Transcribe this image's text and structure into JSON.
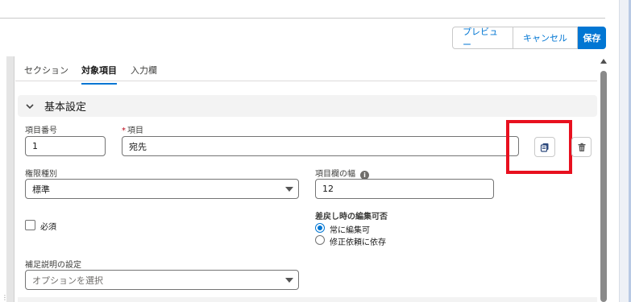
{
  "header": {
    "preview_label": "プレビュー",
    "cancel_label": "キャンセル",
    "save_label": "保存"
  },
  "tabs": [
    {
      "label": "セクション",
      "active": false
    },
    {
      "label": "対象項目",
      "active": true
    },
    {
      "label": "入力欄",
      "active": false
    }
  ],
  "section": {
    "title": "基本設定"
  },
  "fields": {
    "item_number": {
      "label": "項目番号",
      "value": "1"
    },
    "item": {
      "label": "項目",
      "required_mark": "*",
      "value": "宛先"
    },
    "permission_type": {
      "label": "権限種別",
      "value": "標準"
    },
    "field_width": {
      "label": "項目欄の幅",
      "value": "12",
      "info_icon": "info-icon"
    },
    "required": {
      "label": "必須",
      "checked": false
    },
    "edit_on_return": {
      "label": "差戻し時の編集可否",
      "options": [
        {
          "label": "常に編集可",
          "checked": true
        },
        {
          "label": "修正依頼に依存",
          "checked": false
        }
      ]
    },
    "supplement": {
      "label": "補足説明の設定",
      "placeholder": "オプションを選択"
    }
  },
  "icons": {
    "copy": "copy-icon",
    "delete": "trash-icon",
    "section_toggle": "chevron-down-icon"
  },
  "colors": {
    "brand": "#0176d3",
    "highlight": "#e8101f",
    "required": "#ba0517"
  }
}
